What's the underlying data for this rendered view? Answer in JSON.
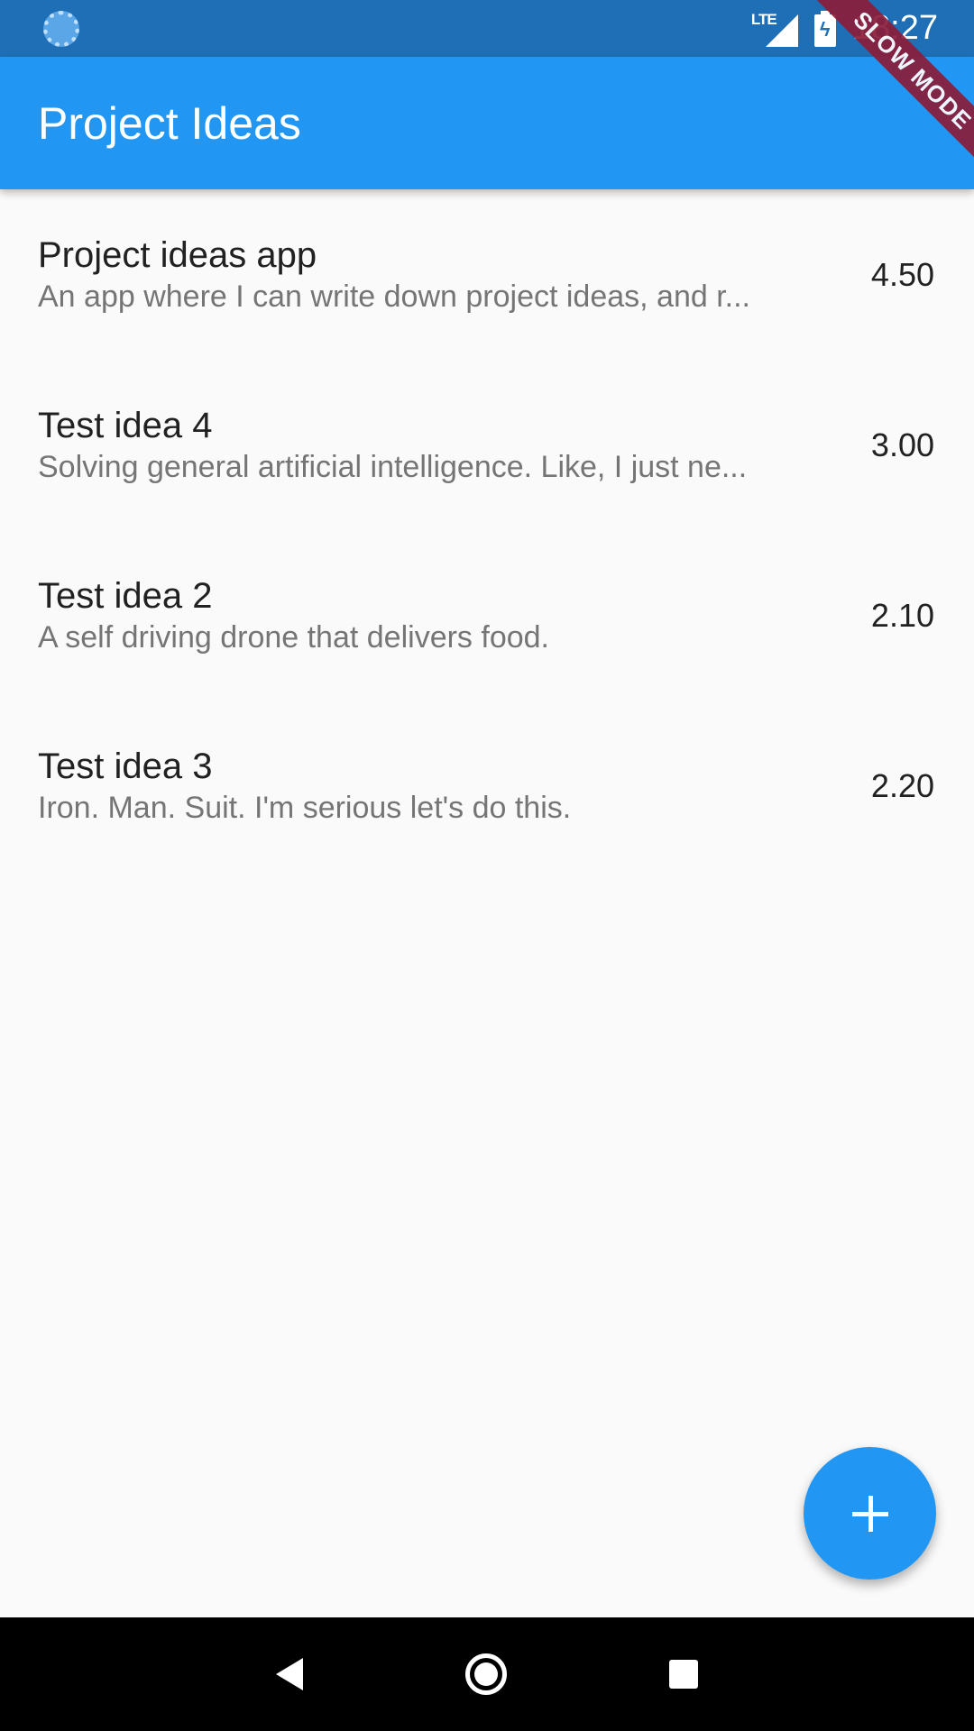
{
  "status_bar": {
    "time": "18:27",
    "network_label": "LTE",
    "icons": [
      "sync-icon",
      "lte-signal-icon",
      "battery-charging-icon"
    ]
  },
  "app_bar": {
    "title": "Project Ideas"
  },
  "debug_banner": {
    "label": "SLOW MODE"
  },
  "ideas": [
    {
      "title": "Project ideas app",
      "description": "An app where I can write down project ideas, and r...",
      "score": "4.50"
    },
    {
      "title": "Test idea 4",
      "description": "Solving general artificial intelligence. Like, I just ne...",
      "score": "3.00"
    },
    {
      "title": "Test idea 2",
      "description": "A self driving drone that delivers food.",
      "score": "2.10"
    },
    {
      "title": "Test idea 3",
      "description": "Iron. Man. Suit. I'm serious let's do this.",
      "score": "2.20"
    }
  ],
  "fab": {
    "icon": "plus-icon"
  },
  "nav_bar": {
    "icons": [
      "back-icon",
      "home-icon",
      "recents-icon"
    ]
  },
  "colors": {
    "primary": "#2196f3",
    "status_bar": "#1e6fb5",
    "background": "#fafafa",
    "banner": "#8b1d3a"
  }
}
